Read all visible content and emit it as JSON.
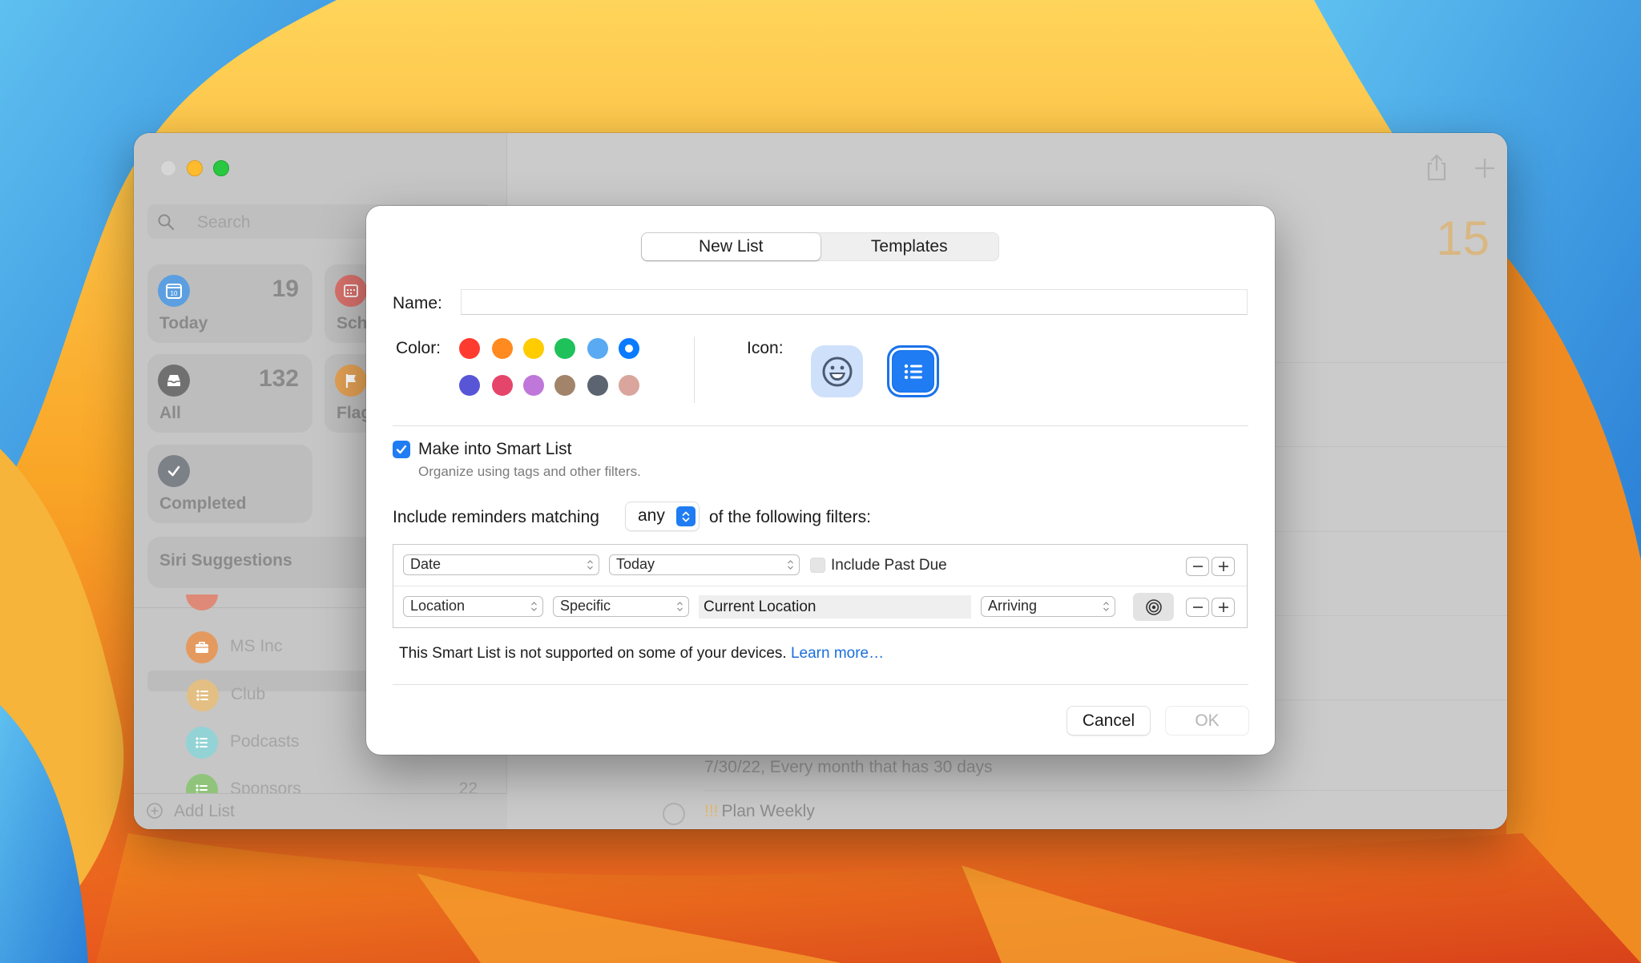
{
  "window": {
    "traffic_lights": [
      "close",
      "minimize",
      "zoom"
    ]
  },
  "sidebar": {
    "search_placeholder": "Search",
    "smart_tiles": [
      {
        "label": "Today",
        "count": "19",
        "icon": "calendar-today-icon",
        "color": "#4a90d9"
      },
      {
        "label": "Scheduled",
        "visible_label": "Sch",
        "count": "",
        "icon": "calendar-grid-icon",
        "color": "#d9635e"
      },
      {
        "label": "All",
        "count": "132",
        "icon": "tray-icon",
        "color": "#6f6f6f"
      },
      {
        "label": "Flagged",
        "visible_label": "Flag",
        "count": "",
        "icon": "flag-icon",
        "color": "#e59a3b"
      },
      {
        "label": "Completed",
        "count": "",
        "icon": "checkmark-icon",
        "color": "#7a7e85"
      }
    ],
    "siri_suggestions": "Siri Suggestions",
    "lists": [
      {
        "label": "MS Inc",
        "icon": "briefcase-icon",
        "color": "#e49a5f",
        "count": ""
      },
      {
        "label": "Club",
        "icon": "list-bullet-icon",
        "color": "#e3bf84",
        "count": "",
        "selected": true
      },
      {
        "label": "Podcasts",
        "icon": "list-bullet-icon",
        "color": "#8fd0d3",
        "count": ""
      },
      {
        "label": "Sponsors",
        "icon": "list-bullet-icon",
        "color": "#8fc47a",
        "count": "22"
      }
    ],
    "add_list": "Add List"
  },
  "main": {
    "count": "15",
    "toolbar": {
      "share": "share-icon",
      "add": "plus-icon"
    },
    "reminders": [
      {
        "subtitle": "7/30/22, Every month that has 30 days"
      },
      {
        "priority": "!!!",
        "title": "Plan Weekly"
      }
    ]
  },
  "dialog": {
    "tabs": [
      {
        "label": "New List",
        "active": true
      },
      {
        "label": "Templates",
        "active": false
      }
    ],
    "name_label": "Name:",
    "name_value": "",
    "color_label": "Color:",
    "colors": [
      {
        "hex": "#ff3b30",
        "selected": false
      },
      {
        "hex": "#ff8a1f",
        "selected": false
      },
      {
        "hex": "#ffcc00",
        "selected": false
      },
      {
        "hex": "#1fc15a",
        "selected": false
      },
      {
        "hex": "#59aaf2",
        "selected": false
      },
      {
        "hex": "#0a7aff",
        "selected": true
      },
      {
        "hex": "#5856d6",
        "selected": false
      },
      {
        "hex": "#e5456a",
        "selected": false
      },
      {
        "hex": "#bf77da",
        "selected": false
      },
      {
        "hex": "#a2846b",
        "selected": false
      },
      {
        "hex": "#5b6470",
        "selected": false
      },
      {
        "hex": "#d9a59c",
        "selected": false
      }
    ],
    "icon_label": "Icon:",
    "icons": [
      {
        "name": "emoji-icon",
        "selected": false
      },
      {
        "name": "list-bullet-icon",
        "selected": true
      }
    ],
    "smart_list": {
      "checked": true,
      "label": "Make into Smart List",
      "subtitle": "Organize using tags and other filters."
    },
    "matching": {
      "prefix": "Include reminders matching",
      "value": "any",
      "suffix": "of the following filters:"
    },
    "filters": [
      {
        "field": "Date",
        "operator": "Today",
        "checkbox_label": "Include Past Due",
        "checkbox_checked": false
      },
      {
        "field": "Location",
        "operator": "Specific",
        "location_value": "Current Location",
        "trigger": "Arriving"
      }
    ],
    "notice": "This Smart List is not supported on some of your devices.",
    "learn_more": "Learn more…",
    "cancel_label": "Cancel",
    "ok_label": "OK"
  }
}
